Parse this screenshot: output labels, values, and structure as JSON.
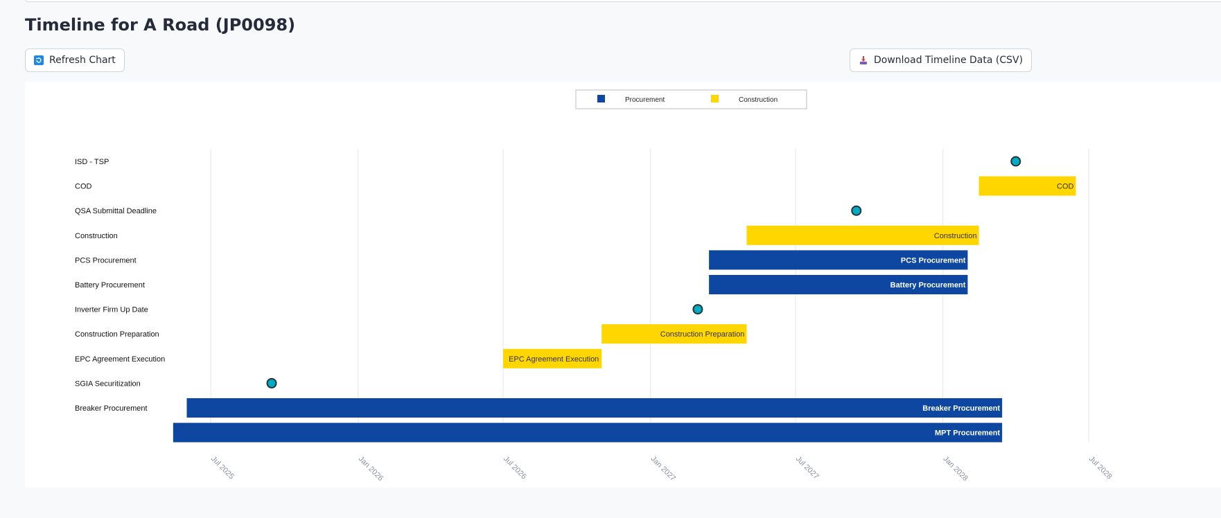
{
  "page": {
    "title": "Timeline for A Road (JP0098)",
    "refresh_label": "Refresh Chart",
    "download_label": "Download Timeline Data (CSV)"
  },
  "icons": {
    "refresh": "refresh-icon",
    "download": "download-icon"
  },
  "colors": {
    "procurement": "#0d47a1",
    "construction": "#ffd600",
    "milestone": "#00acc1",
    "milestone_border": "#263238"
  },
  "chart_data": {
    "type": "gantt",
    "legend": {
      "position": "top-center",
      "items": [
        {
          "name": "Procurement",
          "color": "#0d47a1"
        },
        {
          "name": "Construction",
          "color": "#ffd600"
        }
      ]
    },
    "x_axis": {
      "type": "date",
      "range": [
        "2025-04-01",
        "2028-08-15"
      ],
      "ticks": [
        {
          "date": "2025-07-01",
          "label": "Jul 2025"
        },
        {
          "date": "2026-01-01",
          "label": "Jan 2026"
        },
        {
          "date": "2026-07-01",
          "label": "Jul 2026"
        },
        {
          "date": "2027-01-01",
          "label": "Jan 2027"
        },
        {
          "date": "2027-07-01",
          "label": "Jul 2027"
        },
        {
          "date": "2028-01-01",
          "label": "Jan 2028"
        },
        {
          "date": "2028-07-01",
          "label": "Jul 2028"
        }
      ],
      "grid": true
    },
    "rows": [
      {
        "label": "ISD - TSP",
        "kind": "milestone",
        "date": "2028-04-01"
      },
      {
        "label": "COD",
        "kind": "bar",
        "category": "Construction",
        "start": "2028-02-15",
        "end": "2028-06-15",
        "bar_label": "COD"
      },
      {
        "label": "QSA Submittal   Deadline",
        "kind": "milestone",
        "date": "2027-09-15"
      },
      {
        "label": "Construction",
        "kind": "bar",
        "category": "Construction",
        "start": "2027-05-01",
        "end": "2028-02-15",
        "bar_label": "Construction"
      },
      {
        "label": "PCS   Procurement",
        "kind": "bar",
        "category": "Procurement",
        "start": "2027-03-15",
        "end": "2028-02-01",
        "bar_label": "PCS   Procurement"
      },
      {
        "label": "Battery   Procurement",
        "kind": "bar",
        "category": "Procurement",
        "start": "2027-03-15",
        "end": "2028-02-01",
        "bar_label": "Battery   Procurement"
      },
      {
        "label": "Inverter Firm   Up Date",
        "kind": "milestone",
        "date": "2027-03-01"
      },
      {
        "label": "Construction   Preparation",
        "kind": "bar",
        "category": "Construction",
        "start": "2026-11-01",
        "end": "2027-05-01",
        "bar_label": "Construction   Preparation"
      },
      {
        "label": "EPC Agreement   Execution",
        "kind": "bar",
        "category": "Construction",
        "start": "2026-07-01",
        "end": "2026-11-01",
        "bar_label": "EPC Agreement   Execution"
      },
      {
        "label": "SGIA   Securitization",
        "kind": "milestone",
        "date": "2025-09-15"
      },
      {
        "label": "Breaker   Procurement",
        "kind": "bar",
        "category": "Procurement",
        "start": "2025-06-01",
        "end": "2028-03-15",
        "bar_label": "Breaker   Procurement"
      },
      {
        "label": "",
        "kind": "bar",
        "category": "Procurement",
        "start": "2025-05-15",
        "end": "2028-03-15",
        "bar_label": "MPT   Procurement"
      }
    ]
  }
}
